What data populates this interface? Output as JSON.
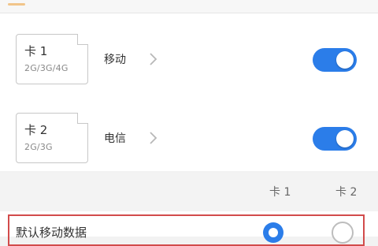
{
  "sims": [
    {
      "title": "卡 1",
      "networks": "2G/3G/4G",
      "carrier": "移动",
      "enabled": true
    },
    {
      "title": "卡 2",
      "networks": "2G/3G",
      "carrier": "电信",
      "enabled": true
    }
  ],
  "default_data": {
    "columns": [
      "卡 1",
      "卡 2"
    ],
    "label": "默认移动数据",
    "selected": "卡 1"
  },
  "colors": {
    "accent": "#2b7de9",
    "highlight_border": "#d24b4b"
  },
  "icons": {
    "chevron": "chevron-right-icon",
    "sim": "sim-card-icon"
  }
}
